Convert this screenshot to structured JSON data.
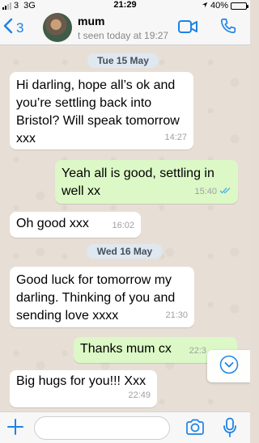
{
  "status_bar": {
    "carrier": "3",
    "network": "3G",
    "time": "21:29",
    "battery_percent": "40%",
    "battery_level": 0.4
  },
  "header": {
    "back_count": "3",
    "contact_name": "mum",
    "last_seen": "t seen today at 19:27"
  },
  "chat": {
    "dates": [
      "Tue 15 May",
      "Wed 16 May"
    ],
    "messages": [
      {
        "direction": "in",
        "lines": [
          "Hi darling, hope all’s ok and",
          "you’re settling back into",
          "Bristol? Will speak tomorrow",
          "xxx"
        ],
        "time": "14:27"
      },
      {
        "direction": "out",
        "lines": [
          "Yeah all is good, settling in",
          "well xx"
        ],
        "time": "15:40",
        "status": "read"
      },
      {
        "direction": "in",
        "lines": [
          "Oh good xxx"
        ],
        "time": "16:02"
      },
      {
        "direction": "in",
        "lines": [
          "Good luck for tomorrow my",
          "darling. Thinking of you and",
          "sending love xxxx"
        ],
        "time": "21:30"
      },
      {
        "direction": "out",
        "lines": [
          "Thanks mum cx"
        ],
        "time": "22:3"
      },
      {
        "direction": "in",
        "lines": [
          "Big hugs for you!!! Xxx"
        ],
        "time": "22:49"
      }
    ]
  },
  "input": {
    "placeholder": "",
    "value": ""
  },
  "colors": {
    "accent": "#1d83e6",
    "incoming_bubble": "#ffffff",
    "outgoing_bubble": "#dcf8c6",
    "read_ticks": "#4fb6ec",
    "chat_background": "#e7dfd6"
  },
  "icons": {
    "back": "chevron-left-icon",
    "video": "video-camera-icon",
    "call": "phone-icon",
    "attach": "plus-icon",
    "camera": "camera-icon",
    "mic": "microphone-icon",
    "scroll": "chevron-down-circle-icon"
  }
}
